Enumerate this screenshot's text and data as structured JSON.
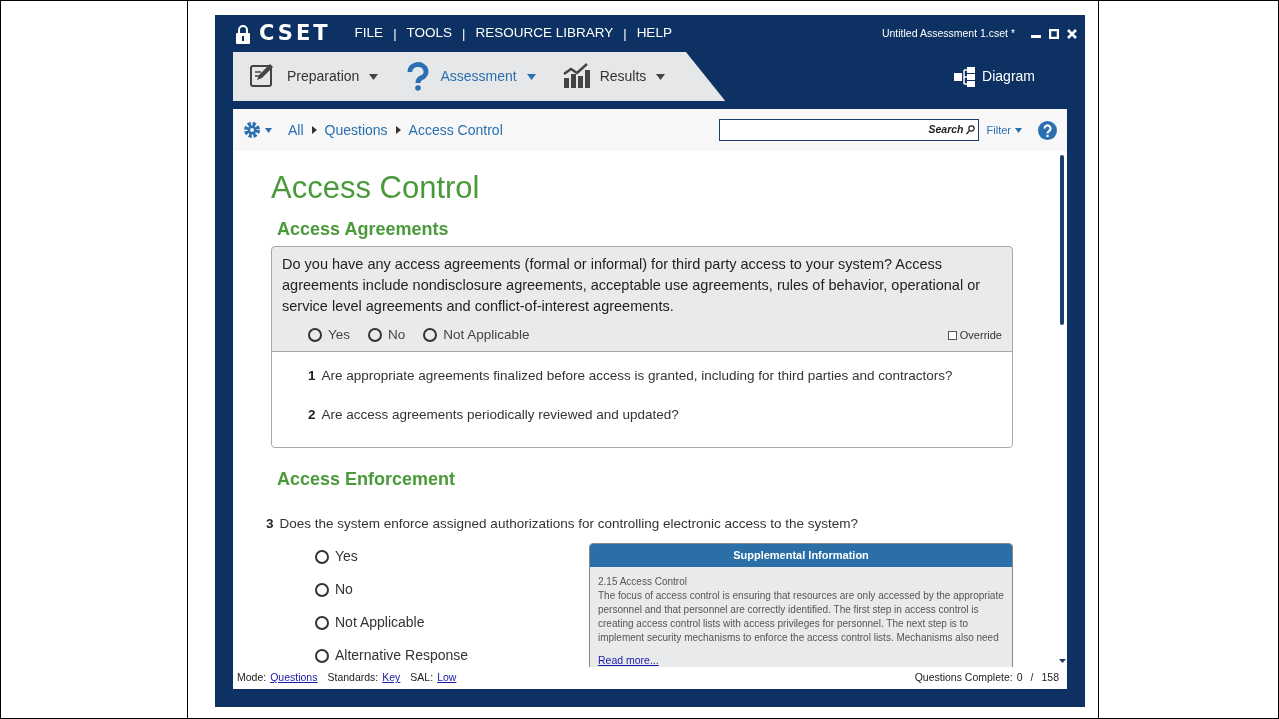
{
  "window": {
    "logo": "CSET",
    "title": "Untitled Assessment 1.cset *"
  },
  "menu": [
    {
      "kind": "item",
      "label": "FILE"
    },
    {
      "kind": "separator",
      "label": "|"
    },
    {
      "kind": "item",
      "label": "TOOLS"
    },
    {
      "kind": "separator",
      "label": "|"
    },
    {
      "kind": "item",
      "label": "RESOURCE LIBRARY"
    },
    {
      "kind": "separator",
      "label": "|"
    },
    {
      "kind": "item",
      "label": "HELP"
    }
  ],
  "tabs": [
    {
      "label": "Preparation",
      "selected": false
    },
    {
      "label": "Assessment",
      "selected": true
    },
    {
      "label": "Results",
      "selected": false
    }
  ],
  "diagram_button": "Diagram",
  "breadcrumb": [
    "All",
    "Questions",
    "Access Control"
  ],
  "search": {
    "button": "Search"
  },
  "filter": "Filter",
  "page_title": "Access Control",
  "sections": [
    {
      "title": "Access Agreements",
      "kind": "group",
      "question": "Do you have any access agreements (formal or informal) for third party access to your system? Access agreements include nondisclosure agreements, acceptable use agreements, rules of behavior, operational or service level agreements and conflict-of-interest agreements.",
      "options": [
        {
          "label": "Yes",
          "selected": false
        },
        {
          "label": "No",
          "selected": false
        },
        {
          "label": "Not Applicable",
          "selected": false
        }
      ],
      "override": {
        "label": "Override",
        "checked": false
      },
      "subquestions": [
        {
          "number": "1",
          "text": "Are appropriate agreements finalized before access is granted, including for third parties and contractors?"
        },
        {
          "number": "2",
          "text": "Are access agreements periodically reviewed and updated?"
        }
      ]
    },
    {
      "title": "Access Enforcement",
      "kind": "single",
      "number": "3",
      "question": "Does the system enforce assigned authorizations for controlling electronic access to the system?",
      "options": [
        {
          "label": "Yes",
          "selected": false
        },
        {
          "label": "No",
          "selected": false
        },
        {
          "label": "Not Applicable",
          "selected": false
        },
        {
          "label": "Alternative Response",
          "selected": false
        }
      ],
      "supplemental": {
        "title": "Supplemental Information",
        "heading": "2.15 Access Control",
        "text": "The focus of access control is ensuring that resources are only accessed by the appropriate personnel and that personnel are correctly identified. The first step in access control is creating access control lists with access privileges for personnel. The next step is to implement security mechanisms to enforce the access control lists. Mechanisms also need",
        "link": "Read more..."
      }
    }
  ],
  "status_bar": {
    "mode_label": "Mode:",
    "mode": "Questions",
    "standards_label": "Standards:",
    "standards": "Key",
    "sal_label": "SAL:",
    "sal": "Low",
    "complete_label": "Questions Complete:",
    "complete": "0",
    "separator": "/",
    "total": "158"
  }
}
